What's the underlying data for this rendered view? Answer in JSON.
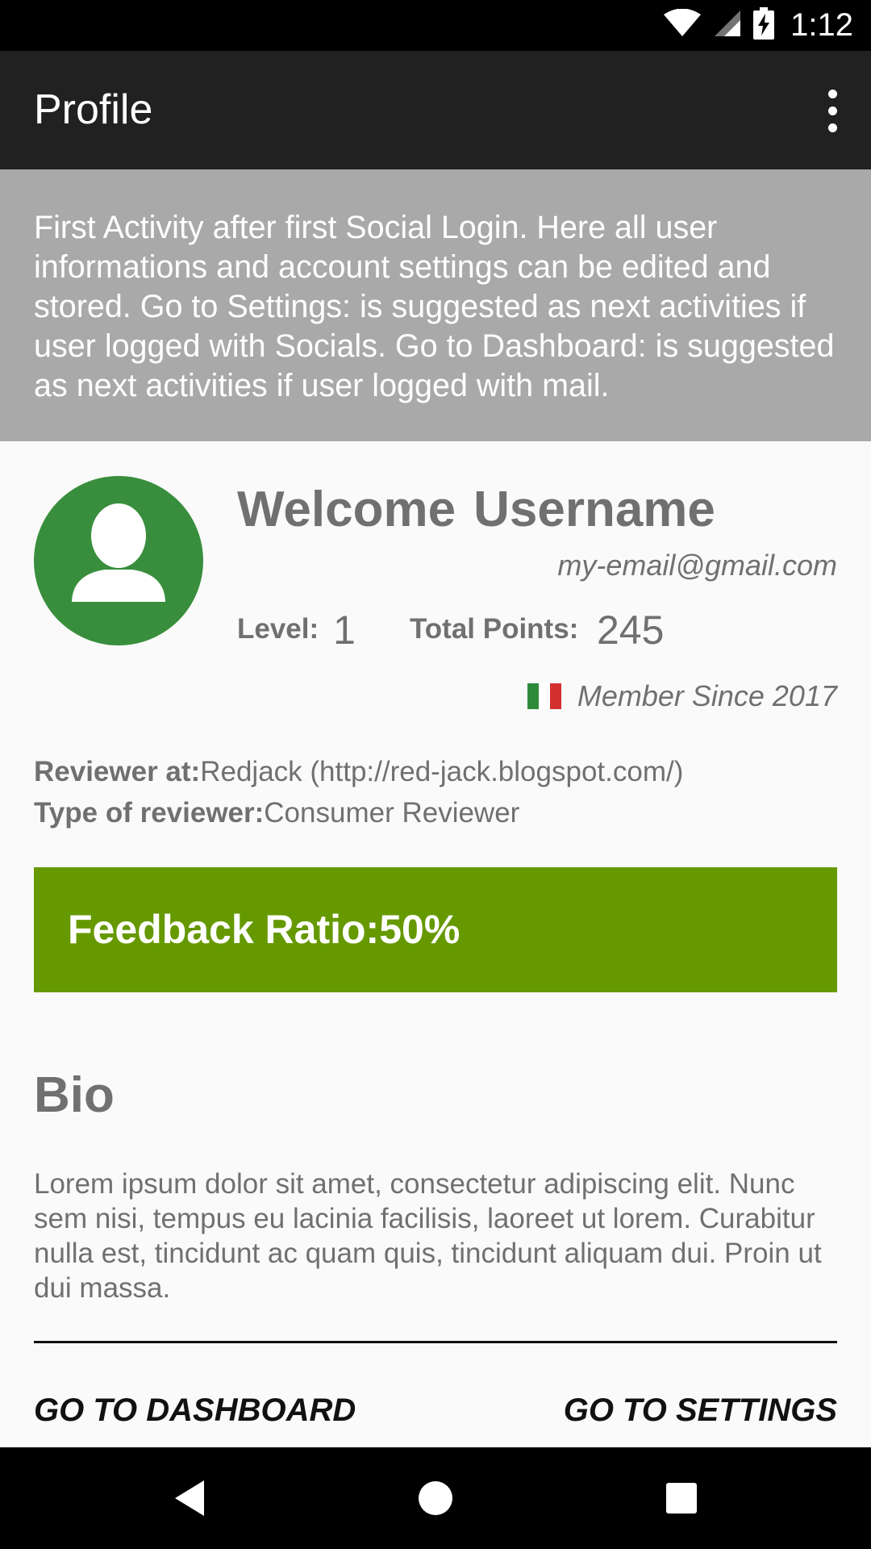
{
  "status_bar": {
    "time": "1:12",
    "icons": [
      "wifi-icon",
      "signal-icon",
      "battery-charging-icon"
    ]
  },
  "app_bar": {
    "title": "Profile",
    "menu_icon": "overflow-menu-icon"
  },
  "info_banner": {
    "text": "First Activity after first Social Login. Here all user informations and account settings can be edited and stored. Go to Settings: is suggested as next activities if user logged with Socials. Go to Dashboard: is suggested as next activities if user logged with mail."
  },
  "profile": {
    "avatar_icon": "person-icon",
    "welcome_word": "Welcome",
    "username": "Username",
    "email": "my-email@gmail.com",
    "level_label": "Level:",
    "level_value": "1",
    "points_label": "Total Points:",
    "points_value": "245",
    "flag_icon": "italy-flag-icon",
    "member_since": "Member Since 2017"
  },
  "reviewer": {
    "at_label": "Reviewer at:",
    "at_value": "Redjack (http://red-jack.blogspot.com/)",
    "type_label": "Type of reviewer:",
    "type_value": "Consumer Reviewer"
  },
  "feedback": {
    "text": "Feedback Ratio:50%",
    "color": "#669900"
  },
  "bio": {
    "title": "Bio",
    "text": "Lorem ipsum dolor sit amet, consectetur adipiscing elit. Nunc sem nisi, tempus eu lacinia facilisis, laoreet ut lorem. Curabitur nulla est, tincidunt ac quam quis, tincidunt aliquam dui. Proin ut dui massa."
  },
  "actions": {
    "dashboard": "GO TO DASHBOARD",
    "settings": "GO TO SETTINGS"
  },
  "nav_bar": {
    "icons": [
      "back-icon",
      "home-icon",
      "recents-icon"
    ]
  },
  "colors": {
    "app_bar": "#212121",
    "banner": "#a9a9a9",
    "avatar": "#388e3c",
    "text_gray": "#707070"
  }
}
